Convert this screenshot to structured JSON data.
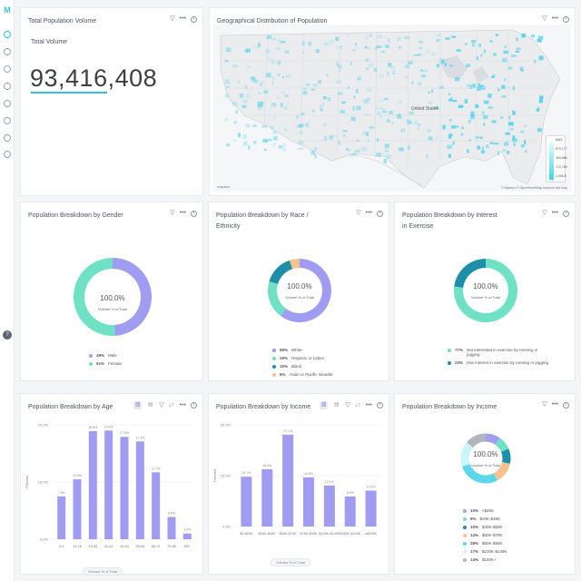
{
  "rail": {
    "logo": "M",
    "items": [
      "st",
      "ch",
      "dt",
      "lt",
      "tr",
      "bk",
      "cfg",
      "alt"
    ],
    "help": "?"
  },
  "colors": {
    "accent": "#3bbfd8",
    "violet": "#9f9cf2",
    "mint": "#6fe1c4",
    "teal": "#1f8ea9",
    "peach": "#f5c28f",
    "aqua": "#5cd7e9"
  },
  "cards": {
    "total": {
      "title": "Total Population Volume",
      "label": "Total Volume",
      "value": "93,416,408"
    },
    "geo": {
      "title": "Geographical Distribution of Population",
      "country_label": "United States",
      "legend_top": "MAX",
      "legend_values": [
        "870,177",
        "463,886",
        "172,789",
        "1,456,8"
      ],
      "attribution": "© Mapbox © OpenStreetMap Improve this map",
      "logo": "mapbox"
    },
    "gender": {
      "title": "Population Breakdown by Gender",
      "center_value": "100.0%",
      "center_label": "Volume % of Total"
    },
    "race": {
      "title_line1": "Population Breakdown by Race /",
      "title_line2": "Ethnicity",
      "center_value": "100.0%",
      "center_label": "Volume % of Total"
    },
    "exercise": {
      "title_line1": "Population Breakdown by Interest",
      "title_line2": "in Exercise",
      "center_value": "100.0%",
      "center_label": "Volume % of Total"
    },
    "age": {
      "title": "Population Breakdown by Age",
      "foot": "Volume % of Total"
    },
    "income_bar": {
      "title": "Population Breakdown by Income",
      "foot": "Volume % of Total"
    },
    "income_donut": {
      "title": "Population Breakdown by Income",
      "center_value": "100.0%",
      "center_label": "Volume % of Total"
    }
  },
  "chart_data": [
    {
      "type": "pie",
      "title": "Population Breakdown by Gender",
      "categories": [
        "Male",
        "Female"
      ],
      "values": [
        49,
        51
      ],
      "labels": [
        "49%",
        "51%"
      ],
      "colors": [
        "#9f9cf2",
        "#6fe1c4"
      ]
    },
    {
      "type": "pie",
      "title": "Population Breakdown by Race / Ethnicity",
      "categories": [
        "White",
        "Hispanic or Latino",
        "Black",
        "Asian or Pacific Islander"
      ],
      "values": [
        59,
        19,
        15,
        5
      ],
      "labels": [
        "59%",
        "19%",
        "15%",
        "5%"
      ],
      "colors": [
        "#9f9cf2",
        "#6fe1c4",
        "#1f8ea9",
        "#f5c28f"
      ]
    },
    {
      "type": "pie",
      "title": "Population Breakdown by Interest in Exercise",
      "categories": [
        "Not interested in exercise by running or jogging",
        "Has interest in exercise by running or jogging"
      ],
      "values": [
        77,
        23
      ],
      "labels": [
        "77%",
        "23%"
      ],
      "colors": [
        "#6fe1c4",
        "#1f8ea9"
      ]
    },
    {
      "type": "bar",
      "title": "Population Breakdown by Age",
      "ylabel": "Percent",
      "categories": [
        "0-9",
        "10-18",
        "19-35",
        "31-42",
        "43-54",
        "55-64",
        "65-74",
        "75-85",
        "85+"
      ],
      "values": [
        7.5,
        10.5,
        18.9,
        19.0,
        17.9,
        17.1,
        11.7,
        3.9,
        1.0
      ],
      "value_labels": [
        "7.5%",
        "10.5%",
        "18.9%",
        "19.0%",
        "17.9%",
        "17.1%",
        "11.7%",
        "3.9%",
        "1.0%"
      ],
      "yticks": [
        "0.0%",
        "10.0%",
        "20.0%"
      ],
      "ylim": [
        0,
        20
      ],
      "legend": "Volume % of Total"
    },
    {
      "type": "bar",
      "title": "Population Breakdown by Income",
      "ylabel": "Percent",
      "categories": [
        "$0-$29K",
        "$30K-$49K",
        "$50K-$74K",
        "$75K-$99K",
        "$100K-$149K",
        "$150K-$199K",
        "≥$200K"
      ],
      "values": [
        14.7,
        16.9,
        27.1,
        14.5,
        12.1,
        8.9,
        10.6
      ],
      "value_labels": [
        "14.7%",
        "16.9%",
        "27.1%",
        "14.5%",
        "12.1%",
        "8.9%",
        "10.6%"
      ],
      "yticks": [
        "0.0%",
        "15.0%",
        "30.0%"
      ],
      "ylim": [
        0,
        30
      ],
      "legend": "Volume % of Total"
    },
    {
      "type": "pie",
      "title": "Population Breakdown by Income",
      "categories": [
        "<$20K",
        "$20K-$39K",
        "$40K-$59K",
        "$60K-$79K",
        "$80K-$99K",
        "$100K-$149K",
        "$150K+"
      ],
      "values": [
        10,
        9,
        10,
        14,
        28,
        17,
        14
      ],
      "labels": [
        "10%",
        "9%",
        "10%",
        "14%",
        "28%",
        "17%",
        "14%"
      ],
      "colors": [
        "#9f9cf2",
        "#6fe1c4",
        "#1f8ea9",
        "#f5c28f",
        "#5cd7e9",
        "#c9f5fb",
        "#b0b6bd"
      ]
    }
  ]
}
